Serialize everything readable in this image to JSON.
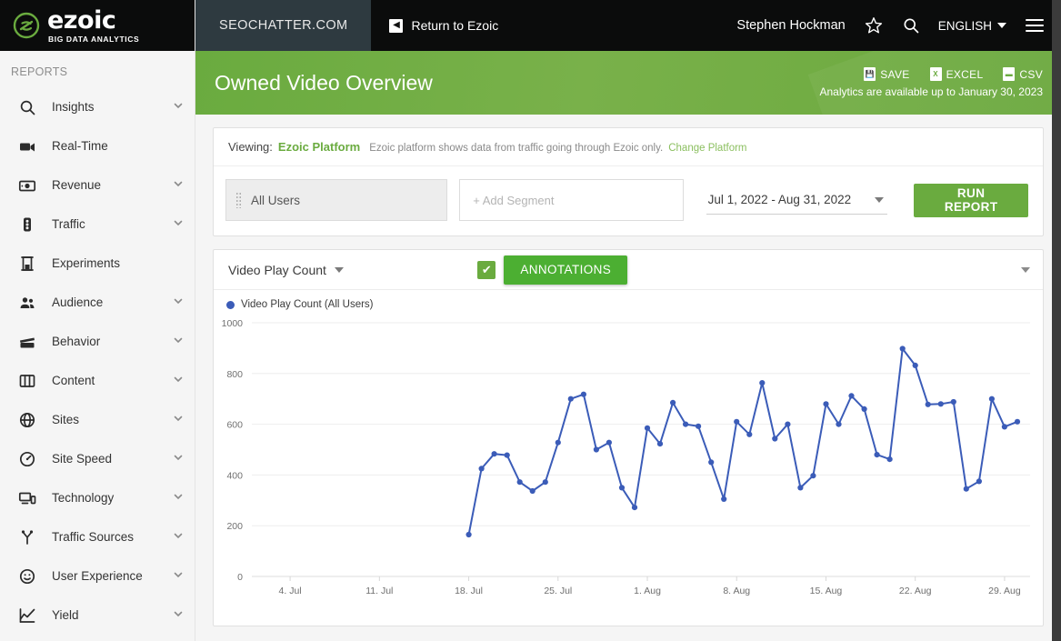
{
  "brand": {
    "name": "ezoic",
    "tagline": "BIG DATA ANALYTICS",
    "logo_icon": "ezoic-logo-icon"
  },
  "topbar": {
    "site_tab": "SEOCHATTER.COM",
    "return_label": "Return to Ezoic",
    "return_icon": "chevron-left-boxed-icon",
    "user_name": "Stephen Hockman",
    "star_icon": "star-icon",
    "search_icon": "search-icon",
    "language": "ENGLISH",
    "menu_icon": "hamburger-menu-icon"
  },
  "page_header": {
    "title": "Owned Video Overview",
    "save_label": "SAVE",
    "excel_label": "EXCEL",
    "csv_label": "CSV",
    "availability": "Analytics are available up to January 30, 2023",
    "accent": "#6aab3f"
  },
  "sidebar": {
    "section_label": "REPORTS",
    "items": [
      {
        "label": "Insights",
        "icon": "search-icon",
        "chevron": true
      },
      {
        "label": "Real-Time",
        "icon": "video-camera-icon",
        "chevron": false
      },
      {
        "label": "Revenue",
        "icon": "money-icon",
        "chevron": true
      },
      {
        "label": "Traffic",
        "icon": "traffic-light-icon",
        "chevron": true
      },
      {
        "label": "Experiments",
        "icon": "flask-icon",
        "chevron": false
      },
      {
        "label": "Audience",
        "icon": "people-icon",
        "chevron": true
      },
      {
        "label": "Behavior",
        "icon": "clapperboard-icon",
        "chevron": true
      },
      {
        "label": "Content",
        "icon": "layout-icon",
        "chevron": true
      },
      {
        "label": "Sites",
        "icon": "globe-icon",
        "chevron": true
      },
      {
        "label": "Site Speed",
        "icon": "gauge-icon",
        "chevron": true
      },
      {
        "label": "Technology",
        "icon": "devices-icon",
        "chevron": true
      },
      {
        "label": "Traffic Sources",
        "icon": "branch-icon",
        "chevron": true
      },
      {
        "label": "User Experience",
        "icon": "smiley-icon",
        "chevron": true
      },
      {
        "label": "Yield",
        "icon": "line-chart-icon",
        "chevron": true
      }
    ]
  },
  "viewing": {
    "label": "Viewing:",
    "platform": "Ezoic Platform",
    "note": "Ezoic platform shows data from traffic going through Ezoic only.",
    "change_link": "Change Platform"
  },
  "segments": {
    "all_users": "All Users",
    "add_segment_placeholder": "+ Add Segment",
    "date_range": "Jul 1, 2022 - Aug 31, 2022",
    "run_report_label": "RUN REPORT"
  },
  "chart_panel": {
    "metric_label": "Video Play Count",
    "annotations_label": "ANNOTATIONS",
    "annotations_checked": true,
    "legend_label": "Video Play Count (All Users)"
  },
  "chart_data": {
    "type": "line",
    "title": "Video Play Count",
    "series": [
      {
        "name": "Video Play Count (All Users)",
        "color": "#3b5cb8",
        "points": [
          {
            "x": "18. Jul",
            "y": 165
          },
          {
            "x": "19. Jul",
            "y": 425
          },
          {
            "x": "20. Jul",
            "y": 483
          },
          {
            "x": "21. Jul",
            "y": 478
          },
          {
            "x": "22. Jul",
            "y": 372
          },
          {
            "x": "23. Jul",
            "y": 337
          },
          {
            "x": "24. Jul",
            "y": 372
          },
          {
            "x": "25. Jul",
            "y": 528
          },
          {
            "x": "26. Jul",
            "y": 700
          },
          {
            "x": "27. Jul",
            "y": 718
          },
          {
            "x": "28. Jul",
            "y": 500
          },
          {
            "x": "29. Jul",
            "y": 528
          },
          {
            "x": "30. Jul",
            "y": 350
          },
          {
            "x": "31. Jul",
            "y": 272
          },
          {
            "x": "1. Aug",
            "y": 585
          },
          {
            "x": "2. Aug",
            "y": 523
          },
          {
            "x": "3. Aug",
            "y": 685
          },
          {
            "x": "4. Aug",
            "y": 600
          },
          {
            "x": "5. Aug",
            "y": 592
          },
          {
            "x": "6. Aug",
            "y": 450
          },
          {
            "x": "7. Aug",
            "y": 305
          },
          {
            "x": "8. Aug",
            "y": 610
          },
          {
            "x": "9. Aug",
            "y": 560
          },
          {
            "x": "10. Aug",
            "y": 763
          },
          {
            "x": "11. Aug",
            "y": 543
          },
          {
            "x": "12. Aug",
            "y": 600
          },
          {
            "x": "13. Aug",
            "y": 350
          },
          {
            "x": "14. Aug",
            "y": 397
          },
          {
            "x": "15. Aug",
            "y": 680
          },
          {
            "x": "16. Aug",
            "y": 600
          },
          {
            "x": "17. Aug",
            "y": 712
          },
          {
            "x": "18. Aug",
            "y": 660
          },
          {
            "x": "19. Aug",
            "y": 480
          },
          {
            "x": "20. Aug",
            "y": 462
          },
          {
            "x": "21. Aug",
            "y": 898
          },
          {
            "x": "22. Aug",
            "y": 832
          },
          {
            "x": "23. Aug",
            "y": 678
          },
          {
            "x": "24. Aug",
            "y": 680
          },
          {
            "x": "25. Aug",
            "y": 688
          },
          {
            "x": "26. Aug",
            "y": 345
          },
          {
            "x": "27. Aug",
            "y": 375
          },
          {
            "x": "28. Aug",
            "y": 700
          },
          {
            "x": "29. Aug",
            "y": 590
          },
          {
            "x": "30. Aug",
            "y": 610
          }
        ]
      }
    ],
    "xlabel": "",
    "ylabel": "",
    "ylim": [
      0,
      1000
    ],
    "ytick_labels": [
      "1000",
      "800",
      "600",
      "400",
      "200",
      "0"
    ],
    "xtick_labels": [
      "4. Jul",
      "11. Jul",
      "18. Jul",
      "25. Jul",
      "1. Aug",
      "8. Aug",
      "15. Aug",
      "22. Aug",
      "29. Aug"
    ],
    "x_domain_start": "1. Jul",
    "x_domain_end": "31. Aug",
    "grid": true,
    "legend_position": "top-left"
  }
}
